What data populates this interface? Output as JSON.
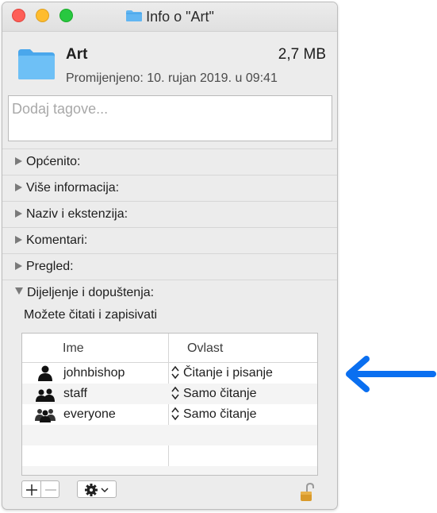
{
  "window": {
    "title": "Info o \"Art\""
  },
  "file": {
    "name": "Art",
    "size": "2,7 MB",
    "modified": "Promijenjeno: 10. rujan 2019. u 09:41"
  },
  "tags": {
    "placeholder": "Dodaj tagove..."
  },
  "sections": [
    {
      "label": "Općenito:",
      "expanded": false
    },
    {
      "label": "Više informacija:",
      "expanded": false
    },
    {
      "label": "Naziv i ekstenzija:",
      "expanded": false
    },
    {
      "label": "Komentari:",
      "expanded": false
    },
    {
      "label": "Pregled:",
      "expanded": false
    },
    {
      "label": "Dijeljenje i dopuštenja:",
      "expanded": true
    }
  ],
  "permissions": {
    "summary": "Možete čitati i zapisivati",
    "columns": {
      "name": "Ime",
      "privilege": "Ovlast"
    },
    "rows": [
      {
        "user": "johnbishop",
        "icon": "single-user-icon",
        "privilege": "Čitanje i pisanje"
      },
      {
        "user": "staff",
        "icon": "group-users-icon",
        "privilege": "Samo čitanje"
      },
      {
        "user": "everyone",
        "icon": "everyone-users-icon",
        "privilege": "Samo čitanje"
      }
    ]
  },
  "toolbar": {
    "add_icon": "plus-icon",
    "remove_icon": "minus-icon",
    "action_icon": "gear-icon",
    "lock_icon": "lock-icon"
  },
  "annotation": {
    "icon": "pointer-arrow",
    "color": "#0a6ff0"
  },
  "colors": {
    "folder": "#62b6f2",
    "folder_dark": "#3f9de6"
  }
}
